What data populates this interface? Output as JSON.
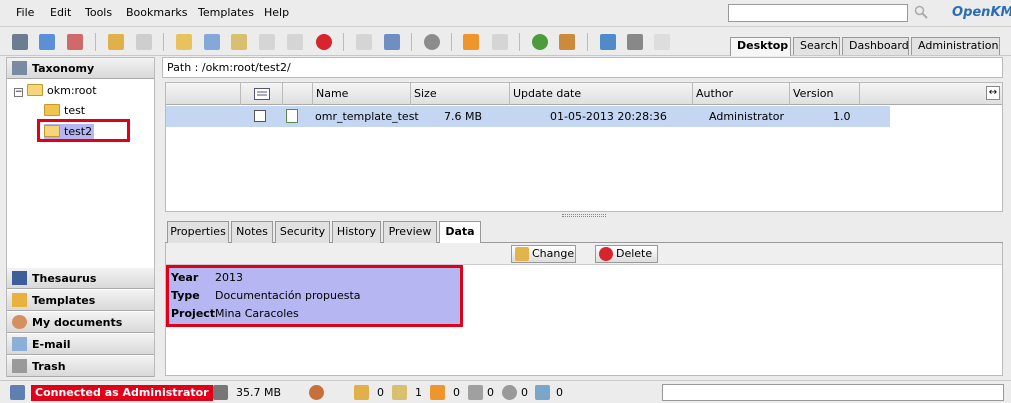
{
  "menu": [
    "File",
    "Edit",
    "Tools",
    "Bookmarks",
    "Templates",
    "Help"
  ],
  "logo": {
    "brand": "penKM",
    "prefix": "O"
  },
  "top_tabs": [
    {
      "label": "Desktop",
      "active": true
    },
    {
      "label": "Search",
      "active": false
    },
    {
      "label": "Dashboard",
      "active": false
    },
    {
      "label": "Administration",
      "active": false
    }
  ],
  "sidebar": {
    "taxonomy_label": "Taxonomy",
    "tree": {
      "root": "okm:root",
      "children": [
        "test",
        "test2"
      ],
      "selected": "test2"
    },
    "sections": [
      "Thesaurus",
      "Templates",
      "My documents",
      "E-mail",
      "Trash"
    ]
  },
  "path": "Path : /okm:root/test2/",
  "table": {
    "headers": [
      "Name",
      "Size",
      "Update date",
      "Author",
      "Version"
    ],
    "rows": [
      {
        "name": "omr_template_test",
        "size": "7.6 MB",
        "update_date": "01-05-2013 20:28:36",
        "author": "Administrator",
        "version": "1.0"
      }
    ]
  },
  "detail_tabs": [
    {
      "label": "Properties",
      "active": false
    },
    {
      "label": "Notes",
      "active": false
    },
    {
      "label": "Security",
      "active": false
    },
    {
      "label": "History",
      "active": false
    },
    {
      "label": "Preview",
      "active": false
    },
    {
      "label": "Data",
      "active": true
    }
  ],
  "data_actions": {
    "change": "Change",
    "delete": "Delete"
  },
  "properties": [
    {
      "key": "Year",
      "value": "2013"
    },
    {
      "key": "Type",
      "value": "Documentación propuesta"
    },
    {
      "key": "Project",
      "value": "Mina Caracoles"
    }
  ],
  "status": {
    "connected": "Connected as Administrator",
    "size": "35.7 MB",
    "counters": [
      "0",
      "1",
      "0",
      "0",
      "0",
      "0"
    ]
  },
  "colors": {
    "highlight": "#e00018",
    "selection": "#c5d6f2",
    "properties_bg": "#b6b6f2"
  }
}
